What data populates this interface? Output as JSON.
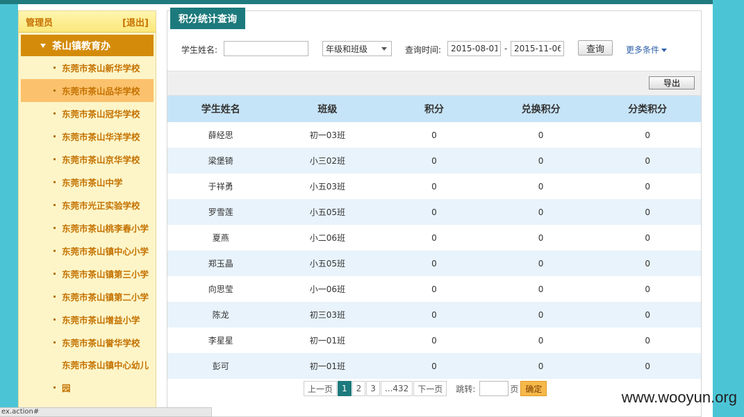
{
  "sidebar": {
    "user_label": "管理员",
    "logout_label": "[退出]",
    "group_label": "茶山镇教育办",
    "items": [
      {
        "label": "东莞市茶山新华学校"
      },
      {
        "label": "东莞市茶山品华学校"
      },
      {
        "label": "东莞市茶山冠华学校"
      },
      {
        "label": "东莞市茶山华洋学校"
      },
      {
        "label": "东莞市茶山京华学校"
      },
      {
        "label": "东莞市茶山中学"
      },
      {
        "label": "东莞市光正实验学校"
      },
      {
        "label": "东莞市茶山桃李春小学"
      },
      {
        "label": "东莞市茶山镇中心小学"
      },
      {
        "label": "东莞市茶山镇第三小学"
      },
      {
        "label": "东莞市茶山镇第二小学"
      },
      {
        "label": "东莞市茶山增益小学"
      },
      {
        "label": "东莞市茶山誉华学校"
      },
      {
        "label": "东莞市茶山镇中心幼儿园"
      }
    ]
  },
  "main": {
    "title": "积分统计查询",
    "search": {
      "name_label": "学生姓名:",
      "name_value": "",
      "grade_select": "年级和班级",
      "time_label": "查询时间:",
      "date_from": "2015-08-01",
      "date_sep": "-",
      "date_to": "2015-11-06",
      "query_label": "查询",
      "more_label": "更多条件"
    },
    "export_label": "导出",
    "table": {
      "headers": [
        "学生姓名",
        "班级",
        "积分",
        "兑换积分",
        "分类积分"
      ],
      "rows": [
        [
          "薛经思",
          "初一03班",
          "0",
          "0",
          "0"
        ],
        [
          "梁堡锜",
          "小三02班",
          "0",
          "0",
          "0"
        ],
        [
          "于祥勇",
          "小五03班",
          "0",
          "0",
          "0"
        ],
        [
          "罗雪莲",
          "小五05班",
          "0",
          "0",
          "0"
        ],
        [
          "夏燕",
          "小二06班",
          "0",
          "0",
          "0"
        ],
        [
          "郑玉晶",
          "小五05班",
          "0",
          "0",
          "0"
        ],
        [
          "向思莹",
          "小一06班",
          "0",
          "0",
          "0"
        ],
        [
          "陈龙",
          "初三03班",
          "0",
          "0",
          "0"
        ],
        [
          "李星星",
          "初一01班",
          "0",
          "0",
          "0"
        ],
        [
          "彭可",
          "初一01班",
          "0",
          "0",
          "0"
        ]
      ]
    },
    "pager": {
      "prev": "上一页",
      "pages": [
        "1",
        "2",
        "3",
        "...432"
      ],
      "next": "下一页",
      "jump_label": "跳转:",
      "page_unit": "页",
      "ok_label": "确定"
    }
  },
  "statusbar": "ex.action#",
  "watermark": "www.wooyun.org"
}
